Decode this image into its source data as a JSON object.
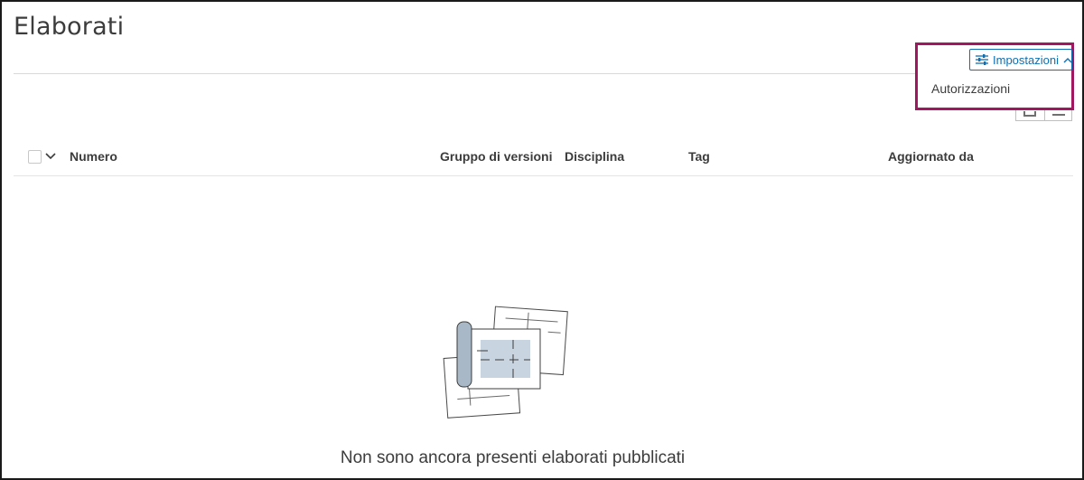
{
  "page": {
    "title": "Elaborati"
  },
  "settings": {
    "button_label": "Impostazioni",
    "menu_items": [
      {
        "label": "Autorizzazioni"
      }
    ],
    "highlight_color": "#a0175f",
    "accent_color": "#0f6fb0"
  },
  "view_toggle": {
    "icons": [
      "grid-view-icon",
      "list-view-icon"
    ]
  },
  "table": {
    "columns": [
      {
        "label": "Numero"
      },
      {
        "label": "Gruppo di versioni"
      },
      {
        "label": "Disciplina"
      },
      {
        "label": "Tag"
      },
      {
        "label": "Aggiornato da"
      }
    ]
  },
  "empty_state": {
    "message": "Non sono ancora presenti elaborati pubblicati",
    "icon": "sheets-illustration-icon"
  }
}
